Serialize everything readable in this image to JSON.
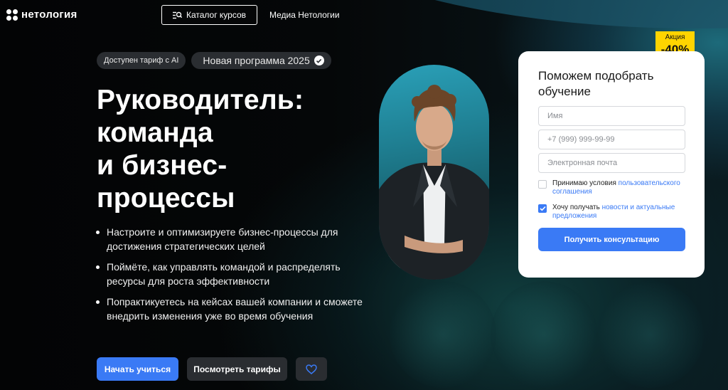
{
  "header": {
    "logo_text": "нетология",
    "catalog_label": "Каталог курсов",
    "media_label": "Медиа Нетологии"
  },
  "badges": {
    "ai_tariff": "Доступен тариф с AI",
    "new_program": "Новая программа 2025"
  },
  "hero": {
    "title_lines": [
      "Руководитель:",
      "команда",
      "и бизнес-",
      "процессы"
    ],
    "bullets": [
      "Настроите и оптимизируете бизнес-процессы для достижения стратегических целей",
      "Поймёте, как управлять командой и распределять ресурсы для роста эффективности",
      "Попрактикуетесь на кейсах вашей компании и сможете внедрить изменения уже во время обучения"
    ],
    "start_label": "Начать учиться",
    "tariffs_label": "Посмотреть тарифы"
  },
  "promo": {
    "line1": "Акция",
    "line2": "-40%"
  },
  "form": {
    "title": "Поможем подобрать обучение",
    "name_placeholder": "Имя",
    "phone_placeholder": "+7 (999) 999-99-99",
    "email_placeholder": "Электронная почта",
    "terms_text": "Принимаю условия ",
    "terms_link": "пользовательского соглашения",
    "terms_checked": false,
    "news_text": "Хочу получать ",
    "news_link": "новости и актуальные предложения",
    "news_checked": true,
    "submit_label": "Получить консультацию"
  },
  "colors": {
    "accent": "#3a7af5",
    "promo": "#ffd400",
    "background": "#050607",
    "chip": "#2a2d31"
  }
}
